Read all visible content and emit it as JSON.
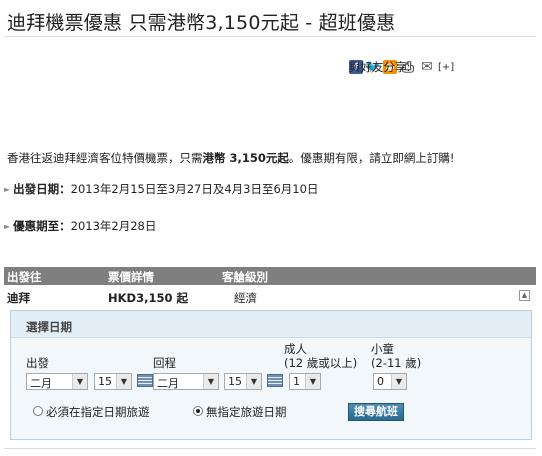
{
  "page": {
    "title": "迪拜機票優惠 只需港幣3,150元起 - 超班優惠"
  },
  "share": {
    "label": "與好友分享:",
    "icons": [
      "facebook-icon",
      "twitter-icon",
      "rss-icon",
      "print-icon",
      "email-icon"
    ],
    "more": "[+]"
  },
  "intro": {
    "prefix": "香港往返迪拜經濟客位特價機票，只需",
    "price": "港幣 3,150元起",
    "suffix": "。優惠期有限，請立即網上訂購!"
  },
  "departure": {
    "label": "出發日期：",
    "value": "2013年2月15日至3月27日及4月3日至6月10日"
  },
  "validity": {
    "label": "優惠期至：",
    "value": "2013年2月28日"
  },
  "table": {
    "headers": [
      "出發往",
      "票價詳情",
      "客艙級別"
    ],
    "row": {
      "destination": "迪拜",
      "fare": "HKD3,150 起",
      "class": "經濟"
    }
  },
  "booking": {
    "title": "選擇日期",
    "depart_label": "出發",
    "return_label": "回程",
    "adult_label": "成人",
    "adult_sub": "(12 歲或以上)",
    "child_label": "小童",
    "child_sub": "(2-11 歲)",
    "depart_month": "二月",
    "depart_day": "15",
    "return_month": "二月",
    "return_day": "15",
    "adults": "1",
    "children": "0",
    "option_fixed": "必須在指定日期旅遊",
    "option_flexible": "無指定旅遊日期",
    "selected_option": "flexible",
    "search_button": "搜尋航班"
  },
  "colors": {
    "table_header": "#7f7f7f",
    "panel_border": "#b7cfe0",
    "button": "#2b6a91"
  }
}
